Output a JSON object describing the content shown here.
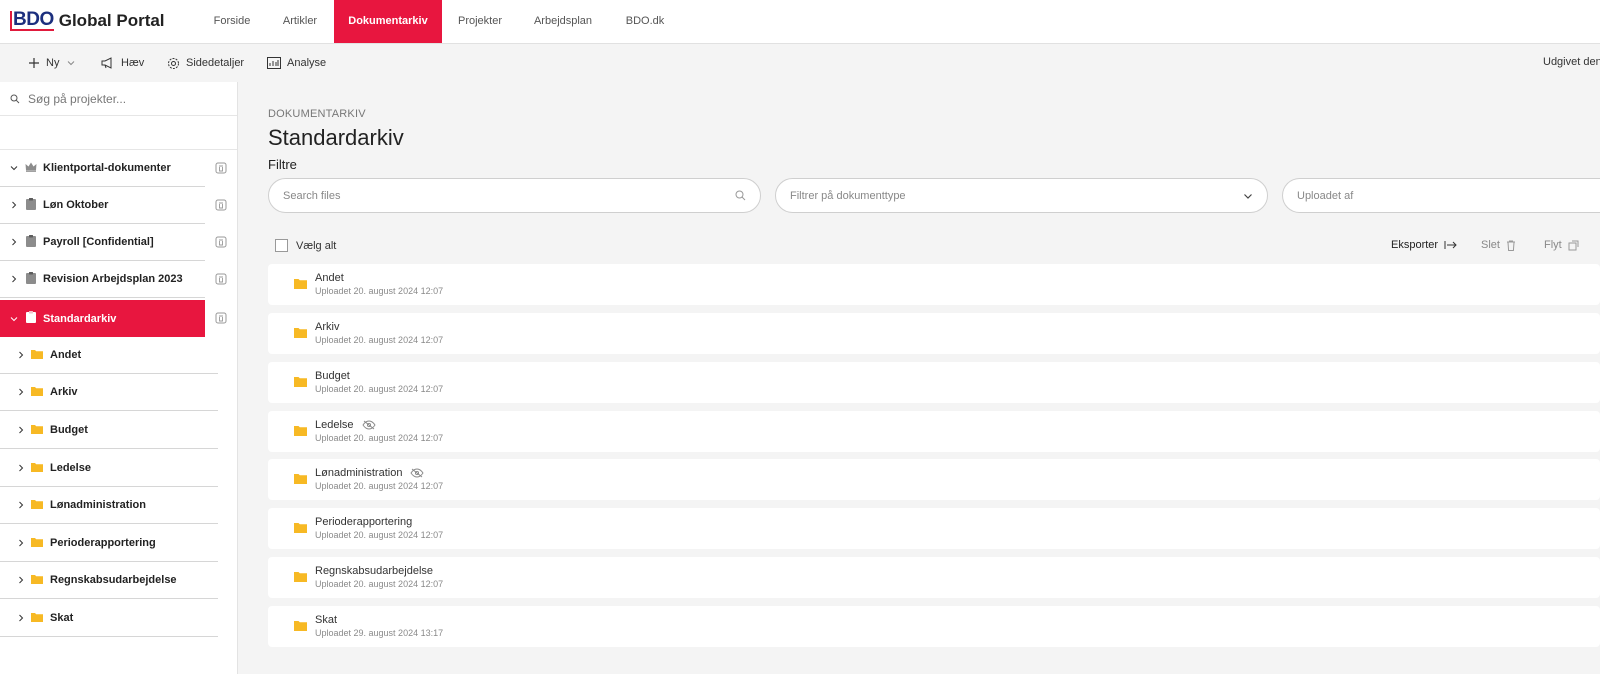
{
  "app": {
    "logo_bdo": "BDO",
    "logo_text": "Global Portal"
  },
  "nav": {
    "items": [
      {
        "label": "Forside"
      },
      {
        "label": "Artikler"
      },
      {
        "label": "Dokumentarkiv",
        "active": true
      },
      {
        "label": "Projekter"
      },
      {
        "label": "Arbejdsplan"
      },
      {
        "label": "BDO.dk"
      }
    ]
  },
  "commands": {
    "new_label": "Ny",
    "promote_label": "Hæv",
    "page_details_label": "Sidedetaljer",
    "analytics_label": "Analyse",
    "published_label": "Udgivet den"
  },
  "sidebar": {
    "search_placeholder": "Søg på projekter...",
    "projects": [
      {
        "label": "Klientportal-dokumenter",
        "icon": "crown-icon",
        "expanded": true
      },
      {
        "label": "Løn Oktober",
        "icon": "clipboard-icon"
      },
      {
        "label": "Payroll [Confidential]",
        "icon": "clipboard-icon"
      },
      {
        "label": "Revision Arbejdsplan 2023",
        "icon": "clipboard-icon"
      },
      {
        "label": "Standardarkiv",
        "icon": "clipboard-icon",
        "selected": true,
        "expanded": true
      }
    ],
    "folders": [
      {
        "label": "Andet"
      },
      {
        "label": "Arkiv"
      },
      {
        "label": "Budget"
      },
      {
        "label": "Ledelse"
      },
      {
        "label": "Lønadministration"
      },
      {
        "label": "Perioderapportering"
      },
      {
        "label": "Regnskabsudarbejdelse"
      },
      {
        "label": "Skat"
      }
    ]
  },
  "main": {
    "breadcrumb": "DOKUMENTARKIV",
    "title": "Standardarkiv",
    "filters_label": "Filtre",
    "search_placeholder": "Search files",
    "doctype_placeholder": "Filtrer på dokumenttype",
    "uploaded_by_placeholder": "Uploadet af",
    "select_all_label": "Vælg alt",
    "export_label": "Eksporter",
    "delete_label": "Slet",
    "move_label": "Flyt",
    "files": [
      {
        "name": "Andet",
        "meta": "Uploadet 20. august 2024 12:07",
        "hidden": false
      },
      {
        "name": "Arkiv",
        "meta": "Uploadet 20. august 2024 12:07",
        "hidden": false
      },
      {
        "name": "Budget",
        "meta": "Uploadet 20. august 2024 12:07",
        "hidden": false
      },
      {
        "name": "Ledelse",
        "meta": "Uploadet 20. august 2024 12:07",
        "hidden": true
      },
      {
        "name": "Lønadministration",
        "meta": "Uploadet 20. august 2024 12:07",
        "hidden": true
      },
      {
        "name": "Perioderapportering",
        "meta": "Uploadet 20. august 2024 12:07",
        "hidden": false
      },
      {
        "name": "Regnskabsudarbejdelse",
        "meta": "Uploadet 20. august 2024 12:07",
        "hidden": false
      },
      {
        "name": "Skat",
        "meta": "Uploadet 29. august 2024 13:17",
        "hidden": false
      }
    ]
  },
  "colors": {
    "accent": "#e8163f",
    "folder": "#f7b924",
    "brand_blue": "#1c2f7e"
  }
}
